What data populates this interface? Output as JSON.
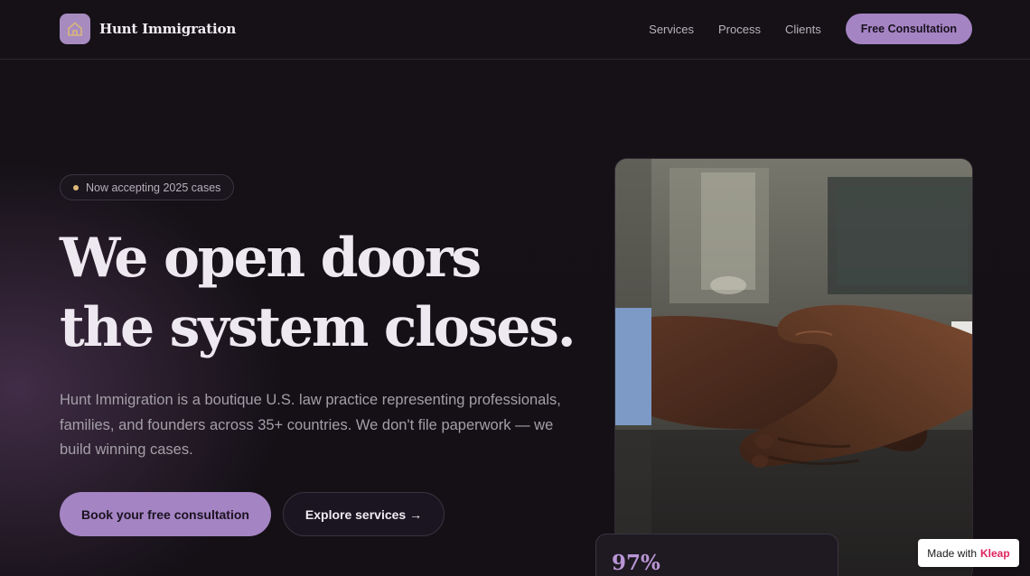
{
  "nav": {
    "brand_name": "Hunt Immigration",
    "links": [
      "Services",
      "Process",
      "Clients"
    ],
    "cta_label": "Free Consultation"
  },
  "hero": {
    "badge": "Now accepting 2025 cases",
    "headline_line1": "We open doors",
    "headline_line2": "the system closes.",
    "description": "Hunt Immigration is a boutique U.S. law practice representing professionals, families, and founders across 35+ countries. We don't file paperwork — we build winning cases.",
    "primary_button": "Book your free consultation",
    "secondary_button": "Explore services →"
  },
  "photo": {
    "subject": "handshake"
  },
  "stat": {
    "value": "97%"
  },
  "made_with": {
    "prefix": "Made with",
    "brand": "Kleap"
  },
  "colors": {
    "background": "#141016",
    "accent": "#a584c4",
    "badge_dot": "#e0b97a",
    "kleap": "#e0245e"
  },
  "icons": {
    "brand_logo": "house-icon"
  }
}
